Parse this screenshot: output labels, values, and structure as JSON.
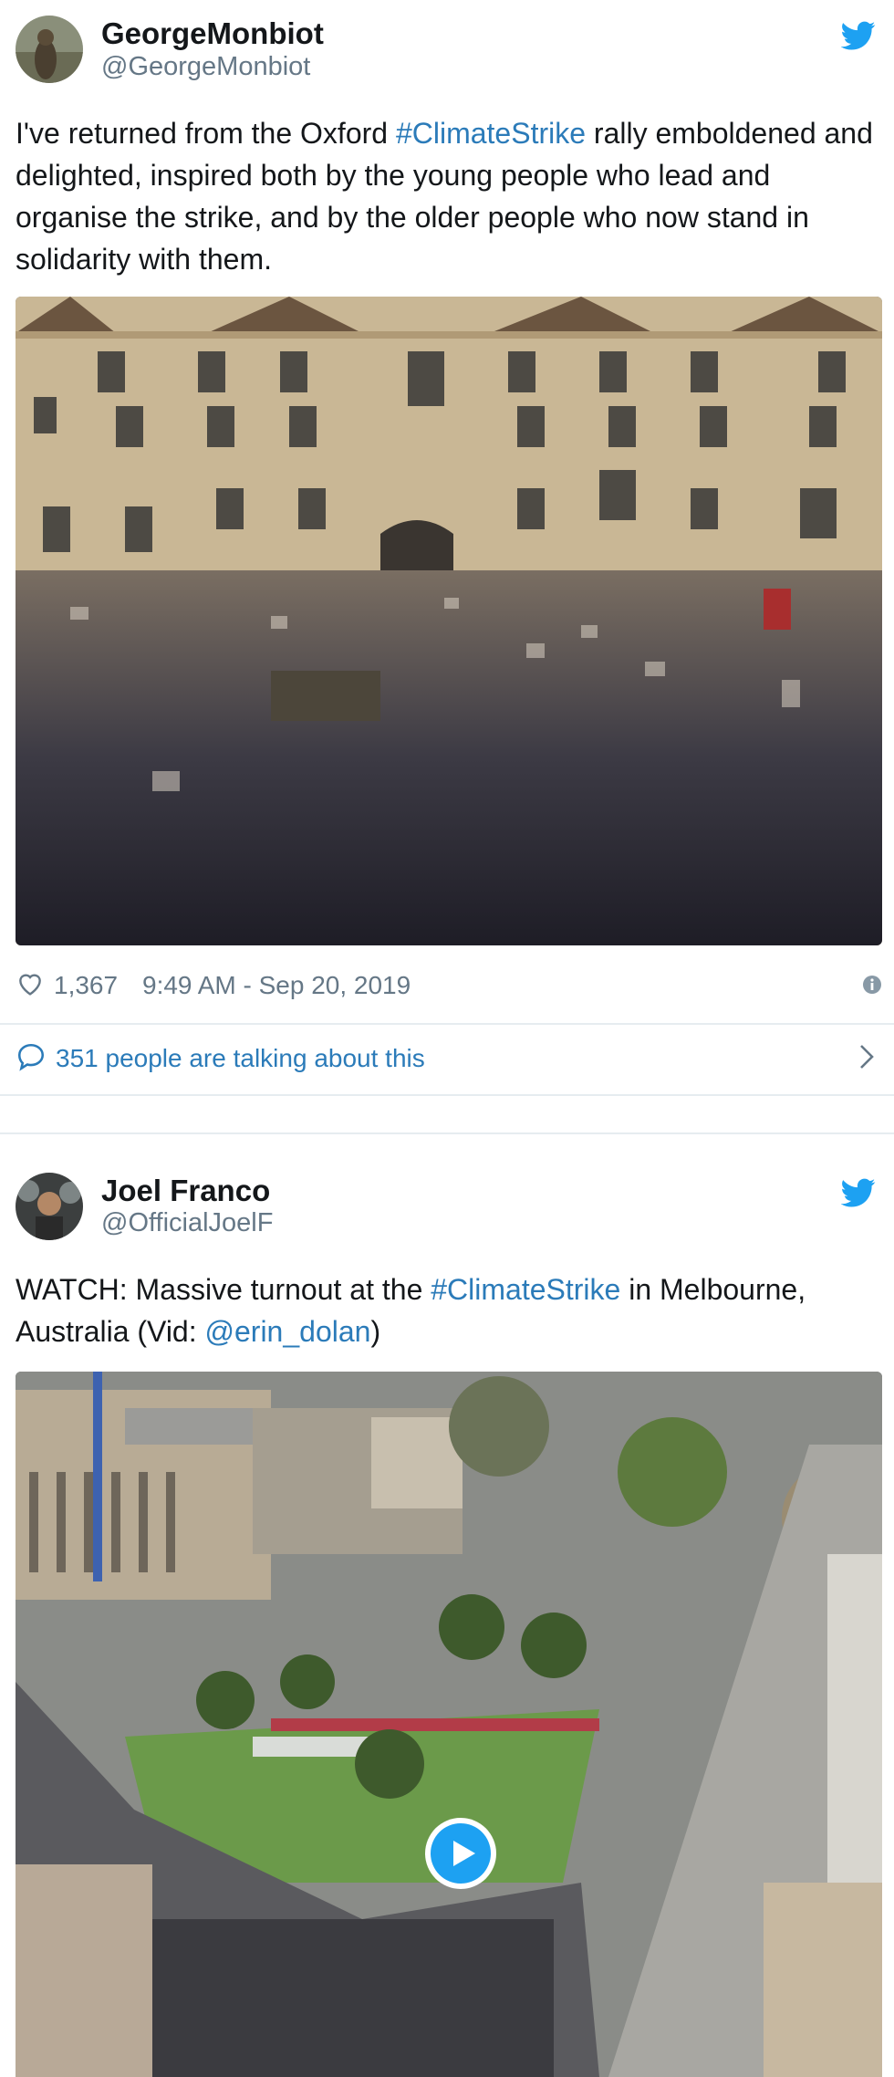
{
  "colors": {
    "link": "#2b7bb9",
    "twitter_blue": "#1da1f2",
    "muted": "#657786",
    "divider": "#e6ecf0"
  },
  "tweet1": {
    "display_name": "GeorgeMonbiot",
    "handle": "@GeorgeMonbiot",
    "text_before": "I've returned from the Oxford ",
    "hashtag": "#ClimateStrike",
    "text_after": " rally emboldened and delighted, inspired both by the young people who lead and organise the strike, and by the older people who now stand in solidarity with them.",
    "likes": "1,367",
    "timestamp": "9:49 AM - Sep 20, 2019",
    "talking": "351 people are talking about this",
    "icons": [
      "heart-icon",
      "info-icon",
      "speech-bubble-icon",
      "chevron-right-icon",
      "twitter-bird-icon"
    ]
  },
  "tweet2": {
    "display_name": "Joel Franco",
    "handle": "@OfficialJoelF",
    "text_before": "WATCH: Massive turnout at the ",
    "hashtag": "#ClimateStrike",
    "text_middle": " in Melbourne, Australia (Vid: ",
    "mention": "@erin_dolan",
    "text_after": ")",
    "icons": [
      "play-icon",
      "twitter-bird-icon"
    ]
  }
}
